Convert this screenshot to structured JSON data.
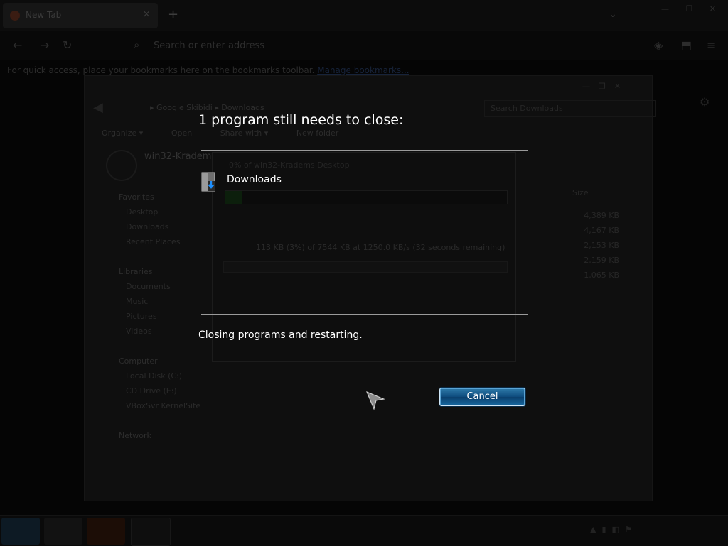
{
  "browser": {
    "tab_title": "New Tab",
    "tab_close": "×",
    "new_tab": "+",
    "tab_list": "⌄",
    "window_controls": "— ❐ ✕",
    "url_placeholder": "Search or enter address",
    "bookmark_hint": "For quick access, place your bookmarks here on the bookmarks toolbar.",
    "bookmark_link": "Manage bookmarks..."
  },
  "explorer": {
    "breadcrumb": "▸ Google Skibidi ▸ Downloads",
    "search_placeholder": "Search Downloads",
    "toolbar": [
      "Organize ▾",
      "Open",
      "Share with ▾",
      "New folder"
    ],
    "user_name": "win32-Kradems",
    "favorites_header": "Favorites",
    "favorites": [
      "Desktop",
      "Downloads",
      "Recent Places"
    ],
    "libraries_header": "Libraries",
    "libraries": [
      "Documents",
      "Music",
      "Pictures",
      "Videos"
    ],
    "computer_header": "Computer",
    "computer": [
      "Local Disk (C:)",
      "CD Drive (E:)",
      "VBoxSvr KernelSite"
    ],
    "network_header": "Network",
    "size_header": "Size",
    "file_sizes": [
      "4,389 KB",
      "4,167 KB",
      "2,153 KB",
      "2,159 KB",
      "1,065 KB"
    ]
  },
  "download_window": {
    "title": "0% of win32-Kradems Desktop",
    "status": "113 KB (3%) of 7544 KB at 1250.0 KB/s (32 seconds remaining)"
  },
  "dialog": {
    "heading": "1 program still needs to close:",
    "program_name": "Downloads",
    "status": "Closing programs and restarting.",
    "cancel_label": "Cancel"
  },
  "colors": {
    "accent_button": "#0f4e80",
    "dialog_text": "#ffffff",
    "divider": "#9a9a9a"
  }
}
